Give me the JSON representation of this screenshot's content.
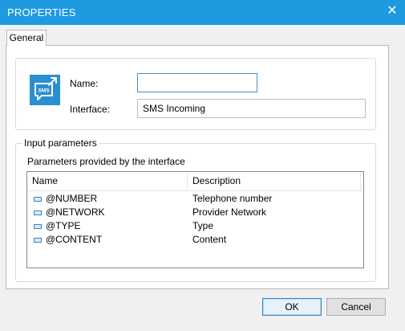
{
  "window": {
    "title": "PROPERTIES",
    "close_glyph": "✕"
  },
  "tabs": [
    {
      "label": "General",
      "selected": true
    }
  ],
  "general": {
    "icon": {
      "name": "sms-incoming-icon",
      "text": "SMS",
      "color": "#2a8fd0"
    },
    "name_label": "Name:",
    "name_value": "",
    "interface_label": "Interface:",
    "interface_value": "SMS Incoming"
  },
  "input_parameters": {
    "group_title": "Input parameters",
    "caption": "Parameters provided by the interface",
    "columns": [
      "Name",
      "Description"
    ],
    "rows": [
      {
        "name": "@NUMBER",
        "description": "Telephone number"
      },
      {
        "name": "@NETWORK",
        "description": "Provider Network"
      },
      {
        "name": "@TYPE",
        "description": "Type"
      },
      {
        "name": "@CONTENT",
        "description": "Content"
      }
    ]
  },
  "buttons": {
    "ok": "OK",
    "cancel": "Cancel"
  },
  "colors": {
    "titlebar": "#1e9ae0",
    "accent": "#3d8fd6"
  }
}
